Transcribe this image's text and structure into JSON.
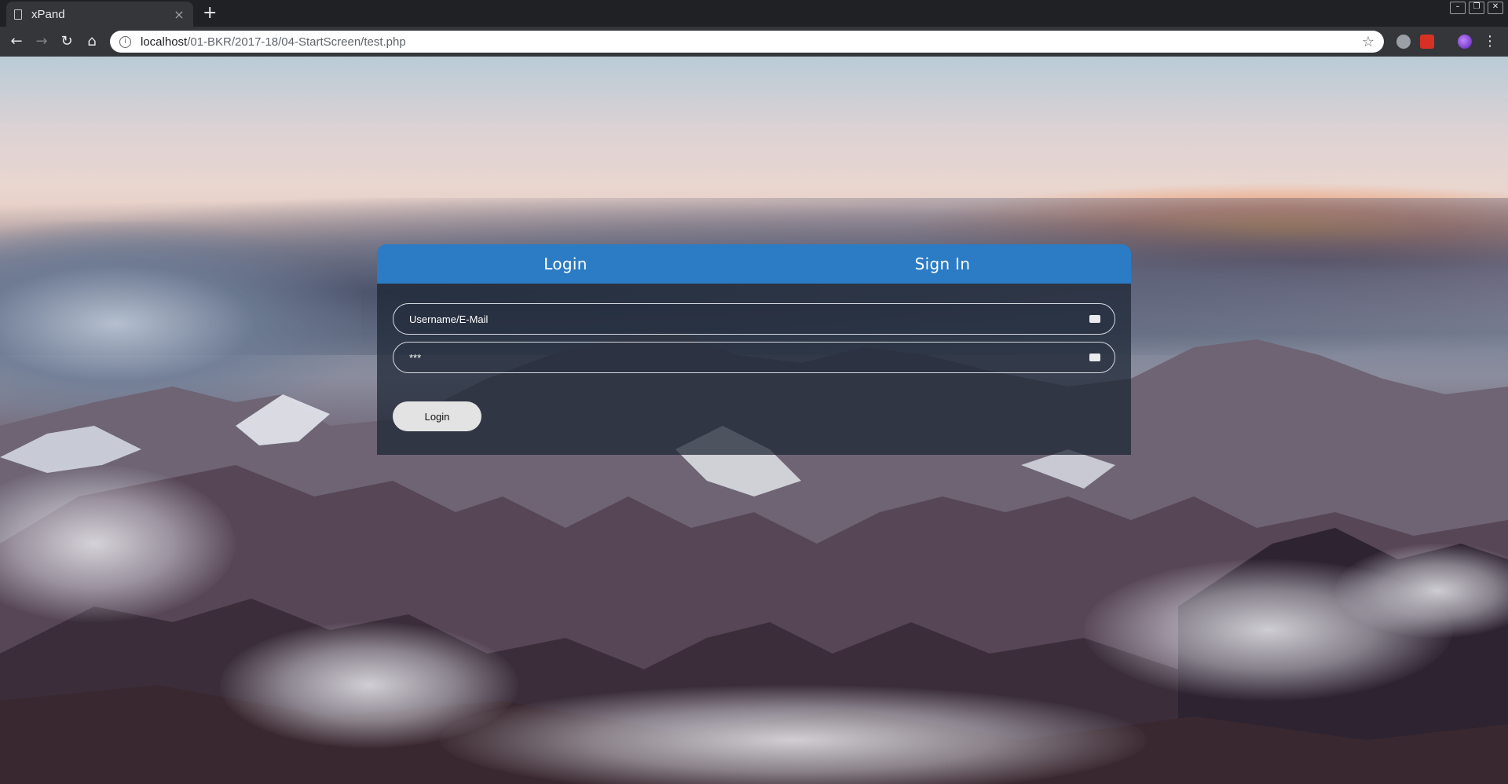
{
  "browser": {
    "tab_title": "xPand",
    "tab_close": "×",
    "new_tab": "+",
    "url_host": "localhost",
    "url_path": "/01-BKR/2017-18/04-StartScreen/test.php",
    "url_info_icon": "i",
    "bookmark_icon": "☆",
    "back_icon": "←",
    "forward_icon": "→",
    "reload_icon": "↻",
    "home_icon": "⌂",
    "menu_icon": "⋮",
    "window_minimize": "–",
    "window_restore": "❐",
    "window_close": "✕"
  },
  "login_panel": {
    "tabs": [
      {
        "label": "Login"
      },
      {
        "label": "Sign In"
      }
    ],
    "username": {
      "value": "Username/E-Mail"
    },
    "password": {
      "value": "***"
    },
    "submit_label": "Login"
  },
  "colors": {
    "tab_bar_blue": "#2b7cc4",
    "panel_dark": "#1a2432"
  }
}
